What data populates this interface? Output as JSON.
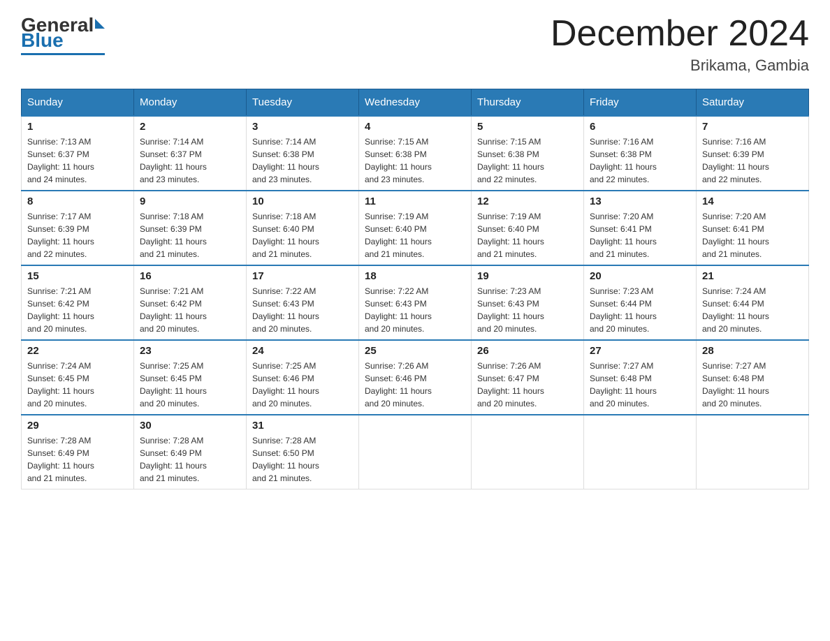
{
  "header": {
    "logo": {
      "general": "General",
      "blue": "Blue"
    },
    "title": "December 2024",
    "location": "Brikama, Gambia"
  },
  "weekdays": [
    "Sunday",
    "Monday",
    "Tuesday",
    "Wednesday",
    "Thursday",
    "Friday",
    "Saturday"
  ],
  "weeks": [
    [
      {
        "day": "1",
        "sunrise": "7:13 AM",
        "sunset": "6:37 PM",
        "daylight": "11 hours and 24 minutes."
      },
      {
        "day": "2",
        "sunrise": "7:14 AM",
        "sunset": "6:37 PM",
        "daylight": "11 hours and 23 minutes."
      },
      {
        "day": "3",
        "sunrise": "7:14 AM",
        "sunset": "6:38 PM",
        "daylight": "11 hours and 23 minutes."
      },
      {
        "day": "4",
        "sunrise": "7:15 AM",
        "sunset": "6:38 PM",
        "daylight": "11 hours and 23 minutes."
      },
      {
        "day": "5",
        "sunrise": "7:15 AM",
        "sunset": "6:38 PM",
        "daylight": "11 hours and 22 minutes."
      },
      {
        "day": "6",
        "sunrise": "7:16 AM",
        "sunset": "6:38 PM",
        "daylight": "11 hours and 22 minutes."
      },
      {
        "day": "7",
        "sunrise": "7:16 AM",
        "sunset": "6:39 PM",
        "daylight": "11 hours and 22 minutes."
      }
    ],
    [
      {
        "day": "8",
        "sunrise": "7:17 AM",
        "sunset": "6:39 PM",
        "daylight": "11 hours and 22 minutes."
      },
      {
        "day": "9",
        "sunrise": "7:18 AM",
        "sunset": "6:39 PM",
        "daylight": "11 hours and 21 minutes."
      },
      {
        "day": "10",
        "sunrise": "7:18 AM",
        "sunset": "6:40 PM",
        "daylight": "11 hours and 21 minutes."
      },
      {
        "day": "11",
        "sunrise": "7:19 AM",
        "sunset": "6:40 PM",
        "daylight": "11 hours and 21 minutes."
      },
      {
        "day": "12",
        "sunrise": "7:19 AM",
        "sunset": "6:40 PM",
        "daylight": "11 hours and 21 minutes."
      },
      {
        "day": "13",
        "sunrise": "7:20 AM",
        "sunset": "6:41 PM",
        "daylight": "11 hours and 21 minutes."
      },
      {
        "day": "14",
        "sunrise": "7:20 AM",
        "sunset": "6:41 PM",
        "daylight": "11 hours and 21 minutes."
      }
    ],
    [
      {
        "day": "15",
        "sunrise": "7:21 AM",
        "sunset": "6:42 PM",
        "daylight": "11 hours and 20 minutes."
      },
      {
        "day": "16",
        "sunrise": "7:21 AM",
        "sunset": "6:42 PM",
        "daylight": "11 hours and 20 minutes."
      },
      {
        "day": "17",
        "sunrise": "7:22 AM",
        "sunset": "6:43 PM",
        "daylight": "11 hours and 20 minutes."
      },
      {
        "day": "18",
        "sunrise": "7:22 AM",
        "sunset": "6:43 PM",
        "daylight": "11 hours and 20 minutes."
      },
      {
        "day": "19",
        "sunrise": "7:23 AM",
        "sunset": "6:43 PM",
        "daylight": "11 hours and 20 minutes."
      },
      {
        "day": "20",
        "sunrise": "7:23 AM",
        "sunset": "6:44 PM",
        "daylight": "11 hours and 20 minutes."
      },
      {
        "day": "21",
        "sunrise": "7:24 AM",
        "sunset": "6:44 PM",
        "daylight": "11 hours and 20 minutes."
      }
    ],
    [
      {
        "day": "22",
        "sunrise": "7:24 AM",
        "sunset": "6:45 PM",
        "daylight": "11 hours and 20 minutes."
      },
      {
        "day": "23",
        "sunrise": "7:25 AM",
        "sunset": "6:45 PM",
        "daylight": "11 hours and 20 minutes."
      },
      {
        "day": "24",
        "sunrise": "7:25 AM",
        "sunset": "6:46 PM",
        "daylight": "11 hours and 20 minutes."
      },
      {
        "day": "25",
        "sunrise": "7:26 AM",
        "sunset": "6:46 PM",
        "daylight": "11 hours and 20 minutes."
      },
      {
        "day": "26",
        "sunrise": "7:26 AM",
        "sunset": "6:47 PM",
        "daylight": "11 hours and 20 minutes."
      },
      {
        "day": "27",
        "sunrise": "7:27 AM",
        "sunset": "6:48 PM",
        "daylight": "11 hours and 20 minutes."
      },
      {
        "day": "28",
        "sunrise": "7:27 AM",
        "sunset": "6:48 PM",
        "daylight": "11 hours and 20 minutes."
      }
    ],
    [
      {
        "day": "29",
        "sunrise": "7:28 AM",
        "sunset": "6:49 PM",
        "daylight": "11 hours and 21 minutes."
      },
      {
        "day": "30",
        "sunrise": "7:28 AM",
        "sunset": "6:49 PM",
        "daylight": "11 hours and 21 minutes."
      },
      {
        "day": "31",
        "sunrise": "7:28 AM",
        "sunset": "6:50 PM",
        "daylight": "11 hours and 21 minutes."
      },
      null,
      null,
      null,
      null
    ]
  ],
  "labels": {
    "sunrise": "Sunrise:",
    "sunset": "Sunset:",
    "daylight": "Daylight:"
  }
}
